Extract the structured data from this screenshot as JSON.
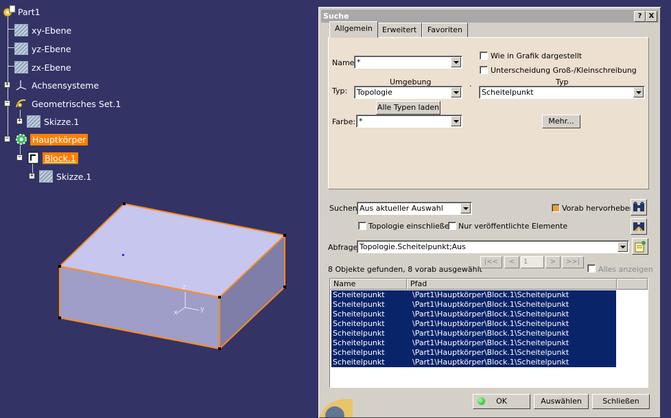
{
  "tree": {
    "root": "Part1",
    "items": [
      "xy-Ebene",
      "yz-Ebene",
      "zx-Ebene",
      "Achsensysteme",
      "Geometrisches Set.1",
      "Skizze.1",
      "Hauptkörper",
      "Block.1",
      "Skizze.1"
    ]
  },
  "dialog": {
    "title": "Suche",
    "help_btn": "?",
    "close_btn": "X",
    "tabs": [
      "Allgemein",
      "Erweitert",
      "Favoriten"
    ],
    "name_label": "Name:",
    "name_value": "*",
    "umgebung_label": "Umgebung",
    "typ_header": "Typ",
    "typ_label": "Typ:",
    "typ_left_value": "Topologie",
    "typ_right_value": "Scheitelpunkt",
    "dot": ".",
    "alle_typen": "Alle Typen laden",
    "farbe_label": "Farbe:",
    "farbe_value": "*",
    "mehr": "Mehr...",
    "cb_grafik": "Wie in Grafik dargestellt",
    "cb_gross": "Unterscheidung Groß-/Kleinschreibung",
    "suchen_label": "Suchen:",
    "suchen_value": "Aus aktueller Auswahl",
    "vorab": "Vorab hervorheben",
    "topo_einschl": "Topologie einschließen",
    "nur_veroeff": "Nur veröffentlichte Elemente",
    "abfrage_label": "Abfrage:",
    "abfrage_value": "Topologie.Scheitelpunkt;Aus",
    "found_text": "8 Objekte gefunden, 8 vorab ausgewählt",
    "nav_first": "|<<",
    "nav_prev": "<",
    "nav_page": "1",
    "nav_next": ">",
    "nav_last": ">>|",
    "alles_anzeigen": "Alles anzeigen",
    "col_name": "Name",
    "col_pfad": "Pfad",
    "rows": [
      {
        "name": "Scheitelpunkt",
        "path": "\\Part1\\Hauptkörper\\Block.1\\Scheitelpunkt"
      },
      {
        "name": "Scheitelpunkt",
        "path": "\\Part1\\Hauptkörper\\Block.1\\Scheitelpunkt"
      },
      {
        "name": "Scheitelpunkt",
        "path": "\\Part1\\Hauptkörper\\Block.1\\Scheitelpunkt"
      },
      {
        "name": "Scheitelpunkt",
        "path": "\\Part1\\Hauptkörper\\Block.1\\Scheitelpunkt"
      },
      {
        "name": "Scheitelpunkt",
        "path": "\\Part1\\Hauptkörper\\Block.1\\Scheitelpunkt"
      },
      {
        "name": "Scheitelpunkt",
        "path": "\\Part1\\Hauptkörper\\Block.1\\Scheitelpunkt"
      },
      {
        "name": "Scheitelpunkt",
        "path": "\\Part1\\Hauptkörper\\Block.1\\Scheitelpunkt"
      },
      {
        "name": "Scheitelpunkt",
        "path": "\\Part1\\Hauptkörper\\Block.1\\Scheitelpunkt"
      }
    ],
    "ok": "OK",
    "auswaehlen": "Auswählen",
    "schliessen": "Schließen"
  },
  "axis": {
    "x": "x",
    "y": "y",
    "z": "z"
  },
  "colors": {
    "background": "#333366",
    "highlight": "#ff7f00",
    "selection": "#0a246a",
    "box_top": "#c6c6ee",
    "box_edge": "#ff8c1a"
  }
}
